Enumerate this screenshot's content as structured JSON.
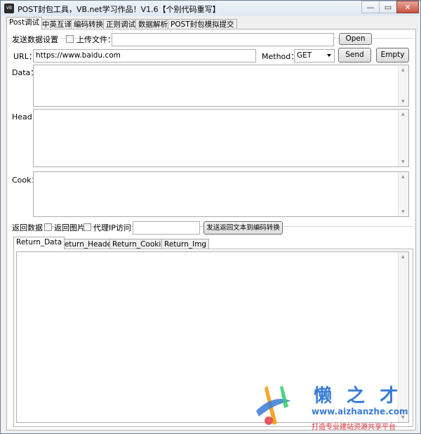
{
  "window": {
    "title": "POST封包工具，VB.net学习作品！V1.6【个别代码重写】",
    "icon_text": "VB",
    "controls": {
      "minimize": "—",
      "maximize": "▭",
      "close": "✕"
    }
  },
  "main_tabs": [
    {
      "label": "Post调试",
      "active": true
    },
    {
      "label": "中英互译",
      "active": false
    },
    {
      "label": "编码转换",
      "active": false
    },
    {
      "label": "正则调试",
      "active": false
    },
    {
      "label": "数据解析",
      "active": false
    },
    {
      "label": "POST封包模拟提交",
      "active": false
    }
  ],
  "send_group": {
    "title": "发送数据设置",
    "upload_label": "上传文件：",
    "upload_value": "",
    "open_button": "Open"
  },
  "url_row": {
    "url_label": "URL：",
    "url_value": "https://www.baidu.com",
    "method_label": "Method：",
    "method_value": "GET",
    "send_button": "Send",
    "empty_button": "Empty"
  },
  "fields": {
    "data_label": "Data：",
    "head_label": "Head：",
    "cook_label": "Cook："
  },
  "return_group": {
    "title": "返回数据",
    "return_image_label": "返回图片",
    "proxy_label": "代理IP访问：",
    "proxy_value": "",
    "convert_button": "发送返回文本到编码转换"
  },
  "return_tabs": [
    {
      "label": "Return_Data",
      "active": true
    },
    {
      "label": "Return_Header",
      "active": false
    },
    {
      "label": "Return_Cookie",
      "active": false
    },
    {
      "label": "Return_Img",
      "active": false
    }
  ],
  "watermark": {
    "title": "懒 之 才",
    "url": "www.aizhanzhe.com",
    "slogan": "打造专业建站资源共享平台",
    "colors": {
      "blue": "#3a7bd5",
      "red": "#e0303a",
      "orange": "#f39c12"
    }
  }
}
